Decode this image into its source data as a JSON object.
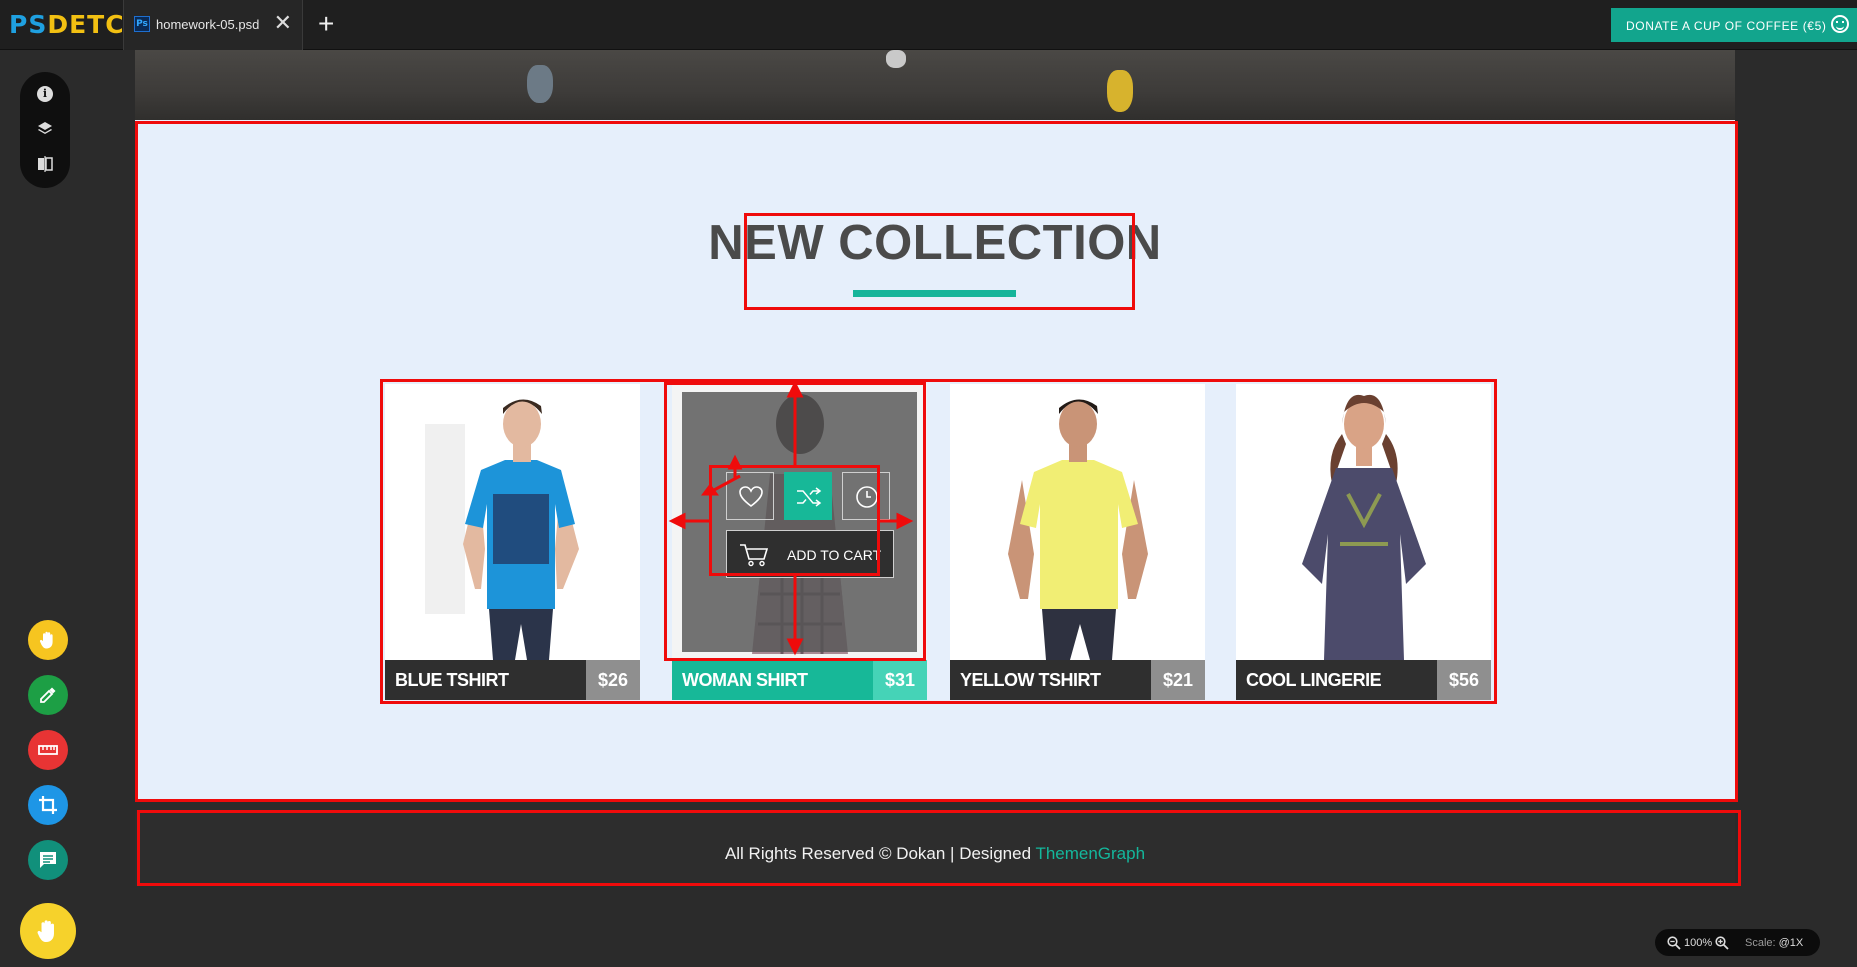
{
  "app": {
    "logo_ps": "PS",
    "logo_detch": "DETCH"
  },
  "tab": {
    "icon_text": "Ps",
    "filename": "homework-05.psd",
    "close": "✕",
    "new_tab": "+"
  },
  "donate": {
    "label": "DONATE A CUP OF COFFEE (€5)"
  },
  "left_panel": {
    "info_glyph": "i"
  },
  "collection": {
    "title": "NEW COLLECTION",
    "products": [
      {
        "name": "BLUE TSHIRT",
        "price": "$26"
      },
      {
        "name": "WOMAN SHIRT",
        "price": "$31"
      },
      {
        "name": "YELLOW TSHIRT",
        "price": "$21"
      },
      {
        "name": "COOL LINGERIE",
        "price": "$56"
      }
    ],
    "add_to_cart": "ADD TO CART"
  },
  "footer": {
    "text": "All Rights Reserved © Dokan | Designed ",
    "brand": "ThemenGraph"
  },
  "zoom": {
    "level": "100%",
    "scale_label": "Scale:",
    "scale_value": "@1X"
  },
  "colors": {
    "accent": "#17b898",
    "selection": "#ef0b0b",
    "brand_blue": "#1fa0e0",
    "brand_yellow": "#f2c012"
  }
}
